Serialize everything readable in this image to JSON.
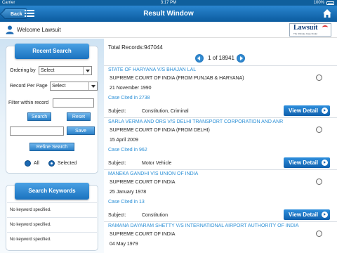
{
  "status_bar": {
    "carrier": "Carrier",
    "time": "3:17 PM",
    "battery": "100%"
  },
  "nav": {
    "back_label": "Back",
    "title": "Result Window"
  },
  "welcome": {
    "text": "Welcome Lawsuit"
  },
  "logo": {
    "name": "Lawsuit",
    "tagline": "The Ultimate Case Finder"
  },
  "recent_search": {
    "header": "Recent Search",
    "ordering_label": "Ordering by",
    "ordering_value": "Select",
    "per_page_label": "Record Per Page",
    "per_page_value": "Select",
    "filter_label": "Filter within record",
    "search_button": "Search",
    "reset_button": "Reset",
    "save_button": "Save",
    "refine_button": "Refine Search",
    "radio_all": "All",
    "radio_selected": "Selected"
  },
  "search_keywords": {
    "header": "Search Keywords",
    "rows": [
      "No keyword specified.",
      "No keyword specified.",
      "No keyword specified."
    ]
  },
  "results": {
    "total": "Total Records:947044",
    "pager": "1 of 18941",
    "subject_label": "Subject:",
    "view_label": "View Detail",
    "items": [
      {
        "title": "STATE OF HARYANA V/S BHAJAN LAL",
        "court": "SUPREME COURT OF INDIA (FROM PUNJAB & HARYANA)",
        "date": "21 November 1990",
        "cited": "Case Cited in 2738",
        "subject": "Constitution, Criminal"
      },
      {
        "title": "SARLA VERMA AND ORS V/S DELHI TRANSPORT CORPORATION AND ANR",
        "court": "SUPREME COURT OF INDIA (FROM DELHI)",
        "date": "15 April 2009",
        "cited": "Case Cited in 962",
        "subject": "Motor Vehicle"
      },
      {
        "title": "MANEKA GANDHI V/S UNION OF INDIA",
        "court": "SUPREME COURT OF INDIA",
        "date": "25 January 1978",
        "cited": "Case Cited in 13",
        "subject": "Constitution"
      },
      {
        "title": "RAMANA DAYARAM SHETTY V/S INTERNATIONAL AIRPORT AUTHORITY OF INDIA",
        "court": "SUPREME COURT OF INDIA",
        "date": "04 May 1979",
        "cited": "",
        "subject": ""
      }
    ]
  }
}
